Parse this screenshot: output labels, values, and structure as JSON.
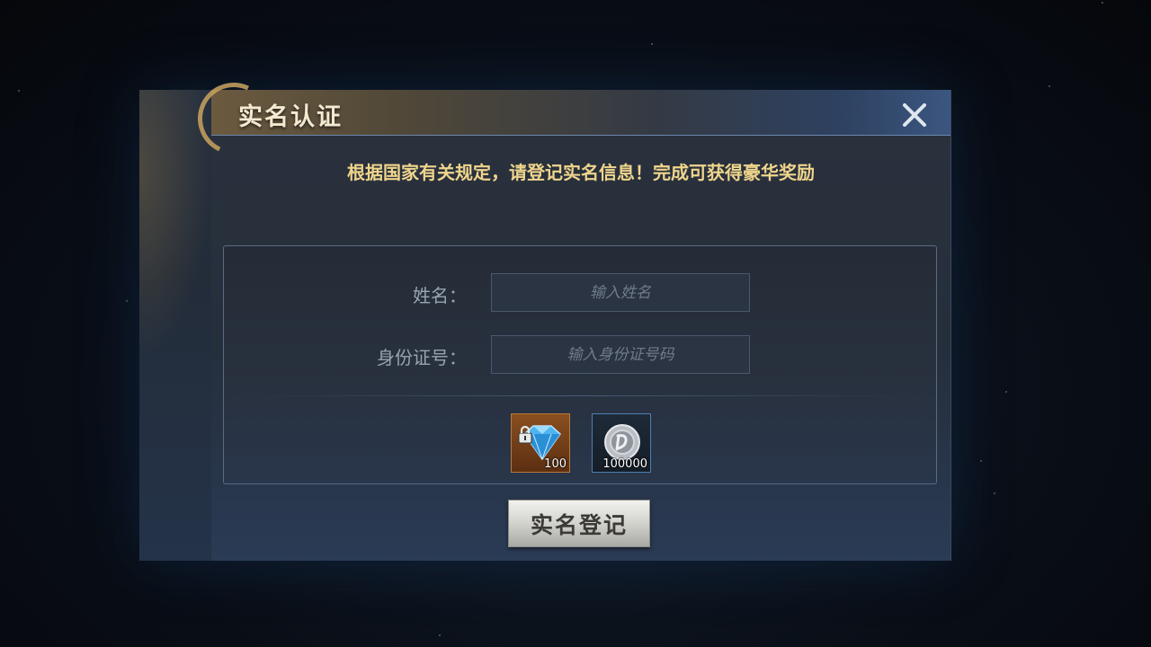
{
  "dialog": {
    "title": "实名认证",
    "notice": "根据国家有关规定，请登记实名信息！完成可获得豪华奖励",
    "close_icon": "close-icon"
  },
  "form": {
    "name_label": "姓名：",
    "name_placeholder": "输入姓名",
    "id_label": "身份证号：",
    "id_placeholder": "输入身份证号码"
  },
  "rewards": [
    {
      "icon": "locked-diamond-icon",
      "quantity": "100"
    },
    {
      "icon": "silver-coin-icon",
      "quantity": "100000"
    }
  ],
  "register_button": "实名登记",
  "colors": {
    "notice": "#efd58c",
    "title": "#f4ead2",
    "panel": "#252e3b",
    "accent_blue": "#6c87ad"
  }
}
